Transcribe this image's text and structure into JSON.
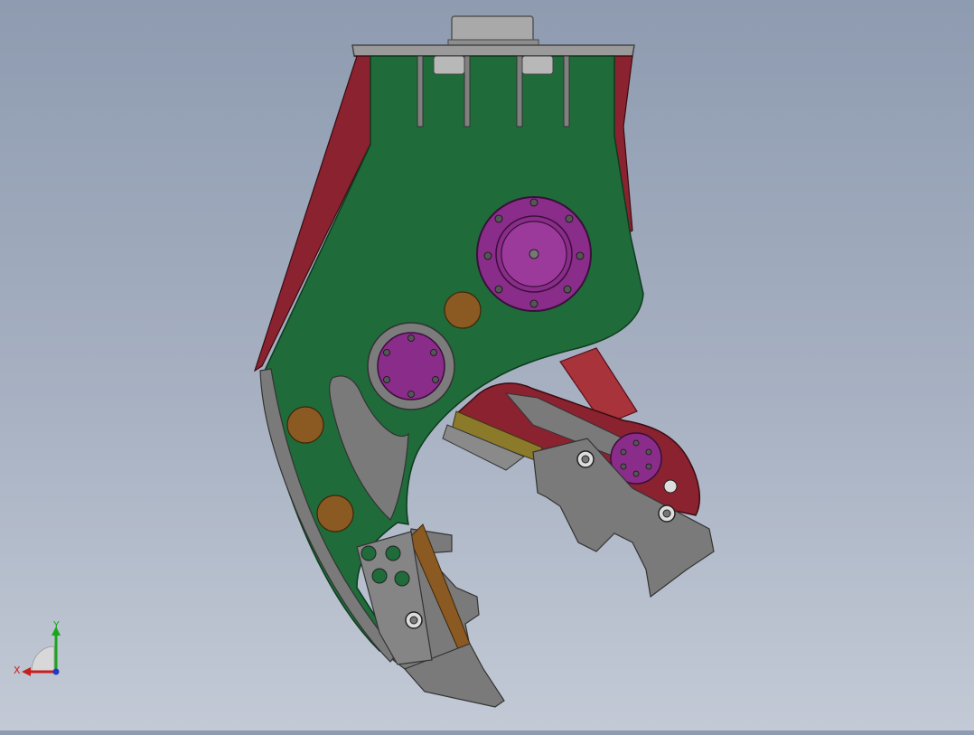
{
  "colors": {
    "background_top": "#8e9bb0",
    "background_bottom": "#c3cad6",
    "body_plate": "#1f6b3a",
    "outline_red": "#8a2230",
    "steel_grey": "#6e6e6e",
    "pivot_purple": "#8a2c8a",
    "bushing_bronze": "#8b5a22",
    "cylinder_red": "#a8333a",
    "wear_plate_olive": "#8a7a2a"
  },
  "triad": {
    "y_label": "Y",
    "x_label": "X",
    "y_color": "#1aa51a",
    "x_color": "#c81e1e",
    "origin_color": "#1e3cc8"
  }
}
